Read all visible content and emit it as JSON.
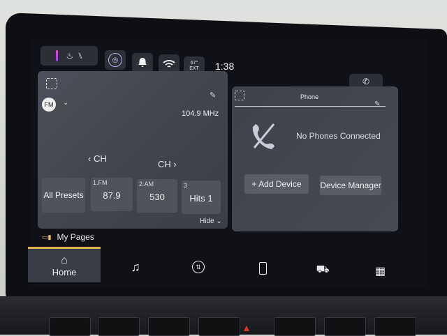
{
  "status": {
    "temp": "67°",
    "temp_unit": "EXT",
    "time": "1:38"
  },
  "radio": {
    "band": "FM",
    "frequency": "104.9 MHz",
    "ch_prev": "CH",
    "ch_next": "CH",
    "all_presets": "All Presets",
    "presets": [
      {
        "num": "1.FM",
        "value": "87.9"
      },
      {
        "num": "2.AM",
        "value": "530"
      },
      {
        "num": "3",
        "value": "Hits 1"
      }
    ],
    "hide": "Hide"
  },
  "phone": {
    "title": "Phone",
    "status": "No Phones Connected",
    "add_device": "+ Add Device",
    "device_manager": "Device Manager"
  },
  "my_pages": "My Pages",
  "nav": {
    "home": "Home",
    "items": [
      "music-icon",
      "climate-icon",
      "phone-icon",
      "vehicle-icon",
      "apps-icon"
    ]
  },
  "colors": {
    "accent": "#e0b24a",
    "hazard": "#d43535"
  }
}
